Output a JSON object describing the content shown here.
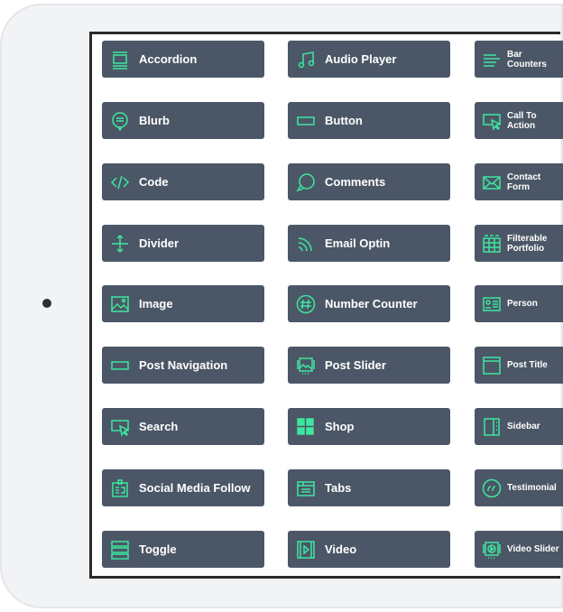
{
  "modules": [
    {
      "label": "Accordion",
      "icon": "accordion-icon"
    },
    {
      "label": "Audio Player",
      "icon": "music-note-icon"
    },
    {
      "label": "Bar Counters",
      "icon": "bar-counter-icon"
    },
    {
      "label": "Blurb",
      "icon": "speech-bubble-icon"
    },
    {
      "label": "Button",
      "icon": "button-icon"
    },
    {
      "label": "Call To Action",
      "icon": "cursor-box-icon"
    },
    {
      "label": "Code",
      "icon": "code-icon"
    },
    {
      "label": "Comments",
      "icon": "comment-icon"
    },
    {
      "label": "Contact Form",
      "icon": "envelope-icon"
    },
    {
      "label": "Divider",
      "icon": "divider-icon"
    },
    {
      "label": "Email Optin",
      "icon": "rss-icon"
    },
    {
      "label": "Filterable Portfolio",
      "icon": "grid-icon"
    },
    {
      "label": "Image",
      "icon": "image-icon"
    },
    {
      "label": "Number Counter",
      "icon": "hash-icon"
    },
    {
      "label": "Person",
      "icon": "id-card-icon"
    },
    {
      "label": "Post Navigation",
      "icon": "post-navigation-icon"
    },
    {
      "label": "Post Slider",
      "icon": "post-slider-icon"
    },
    {
      "label": "Post Title",
      "icon": "post-title-icon"
    },
    {
      "label": "Search",
      "icon": "search-cursor-icon"
    },
    {
      "label": "Shop",
      "icon": "shop-icon"
    },
    {
      "label": "Sidebar",
      "icon": "sidebar-icon"
    },
    {
      "label": "Social Media Follow",
      "icon": "social-follow-icon"
    },
    {
      "label": "Tabs",
      "icon": "tabs-icon"
    },
    {
      "label": "Testimonial",
      "icon": "quote-icon"
    },
    {
      "label": "Toggle",
      "icon": "toggle-icon"
    },
    {
      "label": "Video",
      "icon": "video-icon"
    },
    {
      "label": "Video Slider",
      "icon": "video-slider-icon"
    }
  ],
  "colors": {
    "button_bg": "#4b5766",
    "icon": "#3ee6a0"
  }
}
